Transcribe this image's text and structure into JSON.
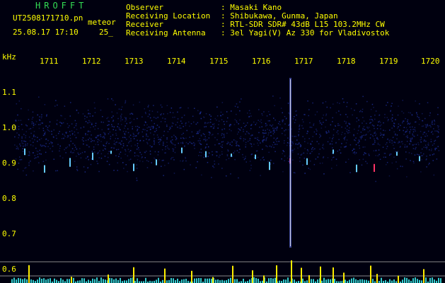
{
  "header": {
    "brand": "HROFFT",
    "filename": "UT2508171710.pn",
    "tag": "meteor",
    "datetime": "25.08.17 17:10",
    "count": "25_",
    "info": [
      {
        "label": "Observer",
        "value": ": Masaki Kano"
      },
      {
        "label": "Receiving Location",
        "value": ": Shibukawa, Gunma, Japan"
      },
      {
        "label": "Receiver",
        "value": ": RTL-SDR SDR# 43dB L15 103.2MHz CW"
      },
      {
        "label": "Receiving Antenna",
        "value": ": 3el Yagi(V) Az 330 for Vladivostok"
      }
    ]
  },
  "axis": {
    "unit": "kHz",
    "x_ticks": [
      "1711",
      "1712",
      "1713",
      "1714",
      "1715",
      "1716",
      "1717",
      "1718",
      "1719",
      "1720"
    ],
    "y_ticks": [
      "1.1",
      "1.0",
      "0.9",
      "0.8",
      "0.7",
      "0.6"
    ]
  },
  "colors": {
    "background": "#00000f",
    "text": "#ffff00",
    "brand": "#33dd55",
    "gridline": "#888888",
    "noise": "#1a2a8a",
    "signal_core": "#ff3366",
    "signal_edge": "#66ccff",
    "bar_low": "#33cccc",
    "bar_high": "#ffee00"
  }
}
